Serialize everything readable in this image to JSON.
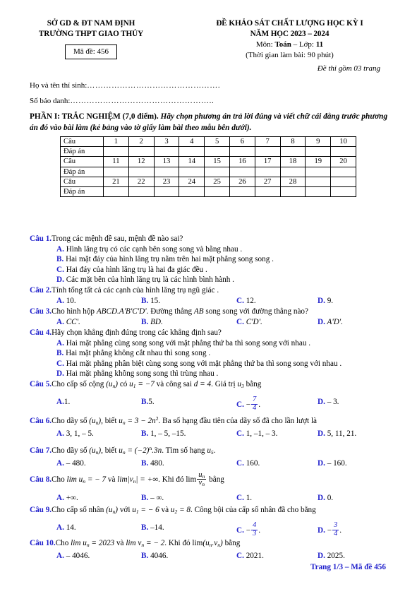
{
  "header": {
    "left": {
      "line1": "SỞ GD & ĐT NAM ĐỊNH",
      "line2": "TRƯỜNG THPT GIAO THỦY",
      "code_label": "Mã đề: 456"
    },
    "right": {
      "line1": "ĐỀ KHẢO SÁT CHẤT LƯỢNG HỌC KỲ I",
      "line2": "NĂM HỌC 2023 – 2024",
      "subject_prefix": "Môn: ",
      "subject": "Toán",
      "grade_sep": " – Lớp: ",
      "grade": "11",
      "duration": "(Thời gian làm bài: 90 phút)"
    },
    "pages_note": "Đề thi gồm 03 trang"
  },
  "candidate": {
    "name_label": "Họ và tên thí sinh:",
    "name_dots": "………………………………………….",
    "sbd_label": "Số báo danh:",
    "sbd_dots": "…………………………………………….."
  },
  "part1": {
    "lead": "PHẦN I: TRẮC NGHIỆM (7,0 điểm).",
    "instruction": " Hãy chọn phương án trả lời đúng và viết chữ cái đằng trước phương án đó vào bài làm (kẻ bảng vào tờ giấy làm bài theo mẫu bên dưới)."
  },
  "answer_table": {
    "row_label_question": "Câu",
    "row_label_answer": "Đáp án",
    "rows": [
      [
        "1",
        "2",
        "3",
        "4",
        "5",
        "6",
        "7",
        "8",
        "9",
        "10"
      ],
      [
        "11",
        "12",
        "13",
        "14",
        "15",
        "16",
        "17",
        "18",
        "19",
        "20"
      ],
      [
        "21",
        "22",
        "23",
        "24",
        "25",
        "26",
        "27",
        "28",
        "",
        ""
      ]
    ]
  },
  "questions": [
    {
      "num": "Câu 1.",
      "stem": "Trong các mệnh đề sau, mệnh đề nào sai?",
      "layout": "stack",
      "options": [
        {
          "letter": "A.",
          "text": " Hình lăng trụ có các cạnh bên song song và bằng nhau ."
        },
        {
          "letter": "B.",
          "text": " Hai mặt đáy của hình lăng trụ nằm trên hai mặt phẳng song song ."
        },
        {
          "letter": "C.",
          "text": " Hai đáy của hình lăng trụ là hai đa giác đều ."
        },
        {
          "letter": "D.",
          "text": " Các mặt bên của hình lăng trụ là các hình bình hành ."
        }
      ]
    },
    {
      "num": "Câu 2.",
      "stem": "Tính tổng tất cả các cạnh của hình lăng trụ ngũ giác .",
      "layout": "row",
      "options": [
        {
          "letter": "A.",
          "text": " 10."
        },
        {
          "letter": "B.",
          "text": " 15."
        },
        {
          "letter": "C.",
          "text": " 12."
        },
        {
          "letter": "D.",
          "text": " 9."
        }
      ]
    },
    {
      "num": "Câu 3.",
      "stem_parts": [
        "Cho hình hộp ",
        "ABCD.A'B'C'D'",
        ". Đường thẳng ",
        "AB",
        " song song với đường thẳng nào?"
      ],
      "layout": "row",
      "options": [
        {
          "letter": "A.",
          "text": " CC'."
        },
        {
          "letter": "B.",
          "text": " BD."
        },
        {
          "letter": "C.",
          "text": " C'D'."
        },
        {
          "letter": "D.",
          "text": " A'D'."
        }
      ]
    },
    {
      "num": "Câu 4.",
      "stem": "Hãy chọn khẳng định đúng trong các khẳng định sau?",
      "layout": "stack",
      "options": [
        {
          "letter": "A.",
          "text": " Hai mặt phẳng cùng song song với mặt phẳng thứ ba thì song song với nhau ."
        },
        {
          "letter": "B.",
          "text": " Hai mặt phẳng không cắt nhau thì song song ."
        },
        {
          "letter": "C.",
          "text": " Hai mặt phẳng phân biệt cùng song song với mặt phẳng thứ ba thì song song với nhau ."
        },
        {
          "letter": "D.",
          "text": " Hai mặt phẳng không song song thì trùng nhau ."
        }
      ]
    },
    {
      "num": "Câu 5.",
      "layout": "row",
      "options": [
        {
          "letter": "A.",
          "text": "1."
        },
        {
          "letter": "B.",
          "text": "5."
        },
        {
          "letter": "C.",
          "text": " ",
          "fraction": {
            "sign": "−",
            "nu": "7",
            "de": "4"
          },
          "suffix": "."
        },
        {
          "letter": "D.",
          "text": " – 3."
        }
      ]
    },
    {
      "num": "Câu 6.",
      "layout": "row",
      "options": [
        {
          "letter": "A.",
          "text": " 3, 1, – 5."
        },
        {
          "letter": "B.",
          "text": " 1, – 5, –15."
        },
        {
          "letter": "C.",
          "text": " 1, –1, – 3."
        },
        {
          "letter": "D.",
          "text": " 5, 11, 21."
        }
      ]
    },
    {
      "num": "Câu 7.",
      "layout": "row",
      "options": [
        {
          "letter": "A.",
          "text": " – 480."
        },
        {
          "letter": "B.",
          "text": " 480."
        },
        {
          "letter": "C.",
          "text": " 160."
        },
        {
          "letter": "D.",
          "text": " – 160."
        }
      ]
    },
    {
      "num": "Câu 8.",
      "layout": "row",
      "options": [
        {
          "letter": "A.",
          "text": " +∞."
        },
        {
          "letter": "B.",
          "text": " – ∞."
        },
        {
          "letter": "C.",
          "text": " 1."
        },
        {
          "letter": "D.",
          "text": " 0."
        }
      ]
    },
    {
      "num": "Câu 9.",
      "layout": "row",
      "options": [
        {
          "letter": "A.",
          "text": " 14."
        },
        {
          "letter": "B.",
          "text": " –14."
        },
        {
          "letter": "C.",
          "text": " ",
          "fraction": {
            "sign": "−",
            "nu": "4",
            "de": "3"
          },
          "suffix": "."
        },
        {
          "letter": "D.",
          "text": " ",
          "fraction": {
            "sign": "−",
            "nu": "3",
            "de": "4"
          },
          "suffix": "."
        }
      ]
    },
    {
      "num": "Câu 10.",
      "layout": "row",
      "options": [
        {
          "letter": "A.",
          "text": " – 4046."
        },
        {
          "letter": "B.",
          "text": " 4046."
        },
        {
          "letter": "C.",
          "text": " 2021."
        },
        {
          "letter": "D.",
          "text": " 2025."
        }
      ]
    }
  ],
  "stems": {
    "q5": {
      "p1": "Cho cấp số cộng ",
      "seq": "(u",
      "seq_sub": "n",
      "seq_end": ")",
      "p2": " có ",
      "u1": "u",
      "u1_sub": "1",
      "u1_val": " = −7",
      "p3": " và công sai ",
      "d": "d",
      "d_val": " = 4",
      "p4": ". Giá trị ",
      "u3": "u",
      "u3_sub": "3",
      "p5": " bằng"
    },
    "q6": {
      "p1": "Cho dãy số ",
      "p2": ", biết ",
      "formula": "u",
      "sub": "n",
      "eq": " = 3 − 2n",
      "exp": "2",
      "p3": ". Ba số hạng đầu tiên của dãy số đã cho lần lượt là"
    },
    "q7": {
      "p1": "Cho dãy số ",
      "p2": ", biết ",
      "formula": "u",
      "sub": "n",
      "eq": " = (−2)",
      "exp": "n",
      "eq2": ".3n",
      "p3": ". Tìm số hạng ",
      "u5": "u",
      "u5_sub": "5",
      "p4": "."
    },
    "q8": {
      "p1": "Cho ",
      "lim1": "lim u",
      "lim1_sub": "n",
      "lim1_val": " = − 7",
      "p2": " và ",
      "lim2": "lim|v",
      "lim2_sub": "n",
      "lim2_val": "| = +∞",
      "p3": ". Khi đó ",
      "lim3": "lim",
      "frac_nu": "u",
      "frac_nu_sub": "n",
      "frac_de": "v",
      "frac_de_sub": "n",
      "p4": " bằng"
    },
    "q9": {
      "p1": "Cho cấp số nhân ",
      "p2": " với ",
      "u1": "u",
      "u1_sub": "1",
      "u1_val": " = − 6",
      "p3": " và ",
      "u2": "u",
      "u2_sub": "2",
      "u2_val": " = 8",
      "p4": ". Công bội của cấp số nhân đã cho bằng"
    },
    "q10": {
      "p1": "Cho ",
      "lim1": "lim u",
      "lim1_sub": "n",
      "lim1_val": " = 2023",
      "p2": " và ",
      "lim2": "lim v",
      "lim2_sub": "n",
      "lim2_val": " = − 2",
      "p3": ". Khi đó ",
      "lim3": "lim",
      "prod": "(u",
      "prod_sub1": "n",
      "prod_mid": ".v",
      "prod_sub2": "n",
      "prod_end": ")",
      "p4": " bằng"
    },
    "seq_un": {
      "open": "(u",
      "sub": "n",
      "close": ")"
    }
  },
  "footer": "Trang 1/3 – Mã đề 456"
}
